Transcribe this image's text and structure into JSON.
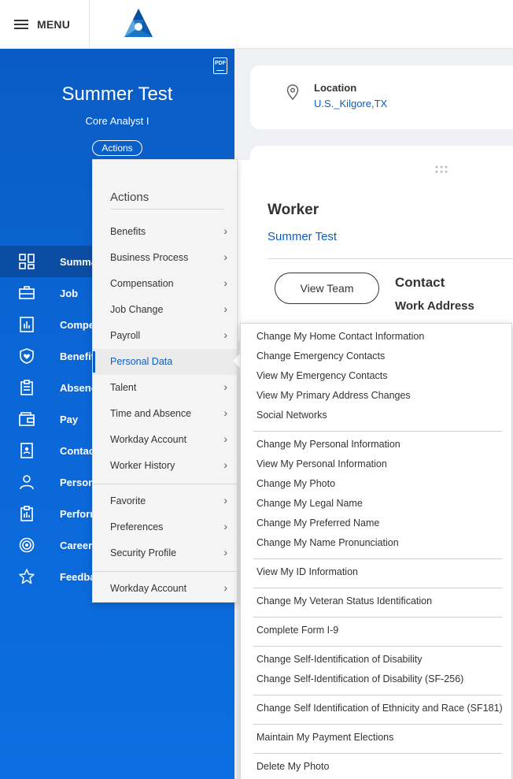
{
  "topbar": {
    "menu_label": "MENU"
  },
  "profile": {
    "name": "Summer Test",
    "job_title": "Core Analyst I",
    "actions_label": "Actions",
    "pdf_label": "PDF"
  },
  "nav": {
    "items": [
      {
        "label": "Summary",
        "icon": "dashboard-icon"
      },
      {
        "label": "Job",
        "icon": "briefcase-icon"
      },
      {
        "label": "Compensation",
        "icon": "chart-icon"
      },
      {
        "label": "Benefits",
        "icon": "shield-heart-icon"
      },
      {
        "label": "Absence",
        "icon": "clipboard-icon"
      },
      {
        "label": "Pay",
        "icon": "wallet-icon"
      },
      {
        "label": "Contact",
        "icon": "contact-book-icon"
      },
      {
        "label": "Personal",
        "icon": "person-icon"
      },
      {
        "label": "Performance",
        "icon": "report-icon"
      },
      {
        "label": "Career",
        "icon": "target-icon"
      },
      {
        "label": "Feedback",
        "icon": "star-icon"
      }
    ]
  },
  "location_card": {
    "title": "Location",
    "value": "U.S._Kilgore,TX"
  },
  "worker_panel": {
    "title": "Worker",
    "name": "Summer Test",
    "view_team_label": "View Team",
    "contact_heading": "Contact",
    "work_address_heading": "Work Address"
  },
  "actions_menu": {
    "heading": "Actions",
    "group1": [
      "Benefits",
      "Business Process",
      "Compensation",
      "Job Change",
      "Payroll",
      "Personal Data",
      "Talent",
      "Time and Absence",
      "Workday Account",
      "Worker History"
    ],
    "group2": [
      "Favorite",
      "Preferences",
      "Security Profile"
    ],
    "group3": [
      "Workday Account"
    ],
    "selected": "Personal Data"
  },
  "submenu": {
    "groups": [
      [
        "Change My Home Contact Information",
        "Change Emergency Contacts",
        "View My Emergency Contacts",
        "View My Primary Address Changes",
        "Social Networks"
      ],
      [
        "Change My Personal Information",
        "View My Personal Information",
        "Change My Photo",
        "Change My Legal Name",
        "Change My Preferred Name",
        "Change My Name Pronunciation"
      ],
      [
        "View My ID Information"
      ],
      [
        "Change My Veteran Status Identification"
      ],
      [
        "Complete Form I-9"
      ],
      [
        "Change Self-Identification of Disability",
        "Change Self-Identification of Disability (SF-256)"
      ],
      [
        "Change Self Identification of Ethnicity and Race (SF181)"
      ],
      [
        "Maintain My Payment Elections"
      ],
      [
        "Delete My Photo"
      ]
    ]
  },
  "colors": {
    "brand_blue": "#0b66d6",
    "link_blue": "#0b5ec4",
    "nav_active": "#0a4da3"
  }
}
